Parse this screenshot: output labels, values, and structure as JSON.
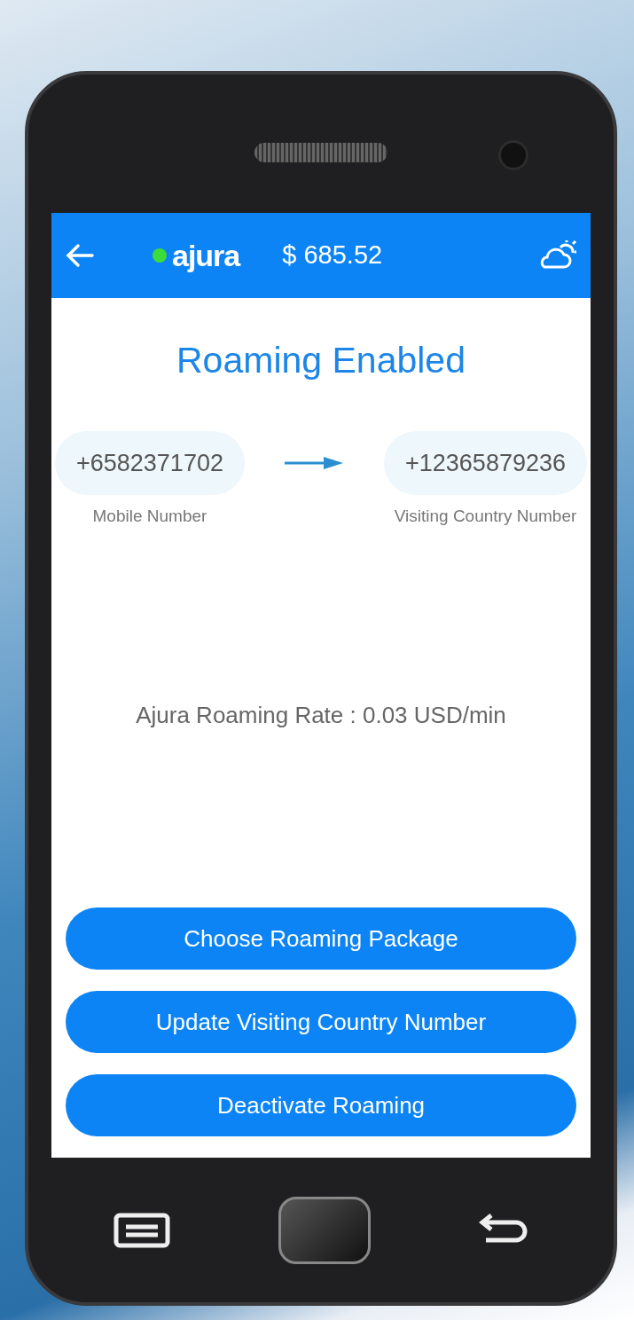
{
  "header": {
    "brand": "ajura",
    "status_dot": {
      "color": "#3ddc3d"
    },
    "balance": "$ 685.52"
  },
  "title": "Roaming Enabled",
  "numbers": [
    {
      "value": "+6582371702",
      "label": "Mobile Number"
    },
    {
      "value": "+12365879236",
      "label": "Visiting Country Number"
    }
  ],
  "rate": "Ajura Roaming Rate : 0.03 USD/min",
  "buttons": [
    "Choose Roaming Package",
    "Update Visiting Country Number",
    "Deactivate Roaming"
  ]
}
